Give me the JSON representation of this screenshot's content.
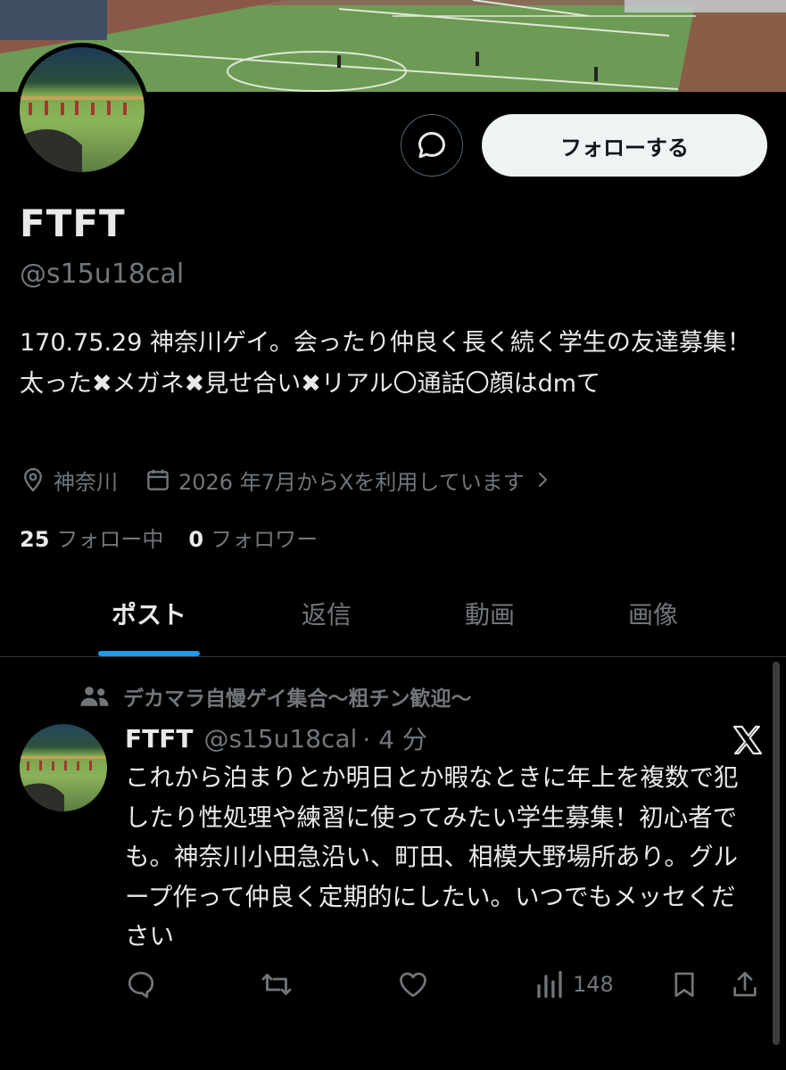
{
  "profile": {
    "display_name": "FTFT",
    "handle": "@s15u18cal",
    "bio": "170.75.29 神奈川ゲイ。会ったり仲良く長く続く学生の友達募集！太った✖メガネ✖見せ合い✖リアル〇通話〇顔はdmて",
    "location": "神奈川",
    "joined": "2026 年7月からXを利用しています",
    "following_count": "25",
    "following_label": "フォロー中",
    "followers_count": "0",
    "followers_label": "フォロワー"
  },
  "buttons": {
    "follow_label": "フォローする"
  },
  "tabs": [
    {
      "label": "ポスト",
      "active": true
    },
    {
      "label": "返信",
      "active": false
    },
    {
      "label": "動画",
      "active": false
    },
    {
      "label": "画像",
      "active": false
    }
  ],
  "post": {
    "community": "デカマラ自慢ゲイ集合〜粗チン歓迎〜",
    "author_name": "FTFT",
    "author_handle": "@s15u18cal",
    "time": "· 4 分",
    "text": "これから泊まりとか明日とか暇なときに年上を複数で犯したり性処理や練習に使ってみたい学生募集！初心者でも。神奈川小田急沿い、町田、相模大野場所あり。グループ作って仲良く定期的にしたい。いつでもメッセください",
    "views": "148"
  },
  "colors": {
    "background": "#000000",
    "text_primary": "#e7e9ea",
    "text_secondary": "#71767b",
    "accent": "#1d9bf0",
    "follow_button_bg": "#eff3f4"
  },
  "icons": [
    "message-icon",
    "location-icon",
    "calendar-icon",
    "chevron-right-icon",
    "community-icon",
    "x-logo-icon",
    "reply-icon",
    "repost-icon",
    "like-icon",
    "views-icon",
    "bookmark-icon",
    "share-icon"
  ]
}
